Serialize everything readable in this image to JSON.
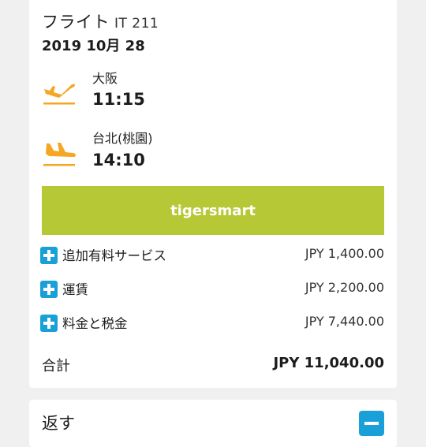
{
  "flight": {
    "label": "フライト",
    "number": "IT 211",
    "date": "2019 10月 28"
  },
  "departure": {
    "city": "大阪",
    "time": "11:15",
    "icon": "takeoff-icon"
  },
  "arrival": {
    "city": "台北(桃園)",
    "time": "14:10",
    "icon": "landing-icon"
  },
  "promo": {
    "label": "tigersmart"
  },
  "charges": [
    {
      "label": "追加有料サービス",
      "amount": "JPY 1,400.00"
    },
    {
      "label": "運賃",
      "amount": "JPY 2,200.00"
    },
    {
      "label": "料金と税金",
      "amount": "JPY 7,440.00"
    }
  ],
  "total": {
    "label": "合計",
    "amount": "JPY 11,040.00"
  },
  "return_section": {
    "label": "返す"
  },
  "colors": {
    "accent": "#b6c835",
    "plus": "#1aa0d8",
    "plane": "#f5a623"
  }
}
